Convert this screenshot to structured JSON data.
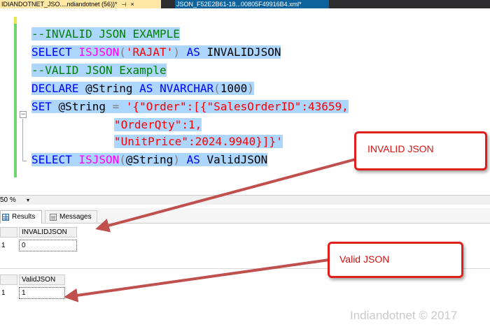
{
  "tabs": {
    "active": "IDIANDOTNET_JSO....ndiandotnet (56))*",
    "active_pin": "⊣",
    "active_close": "×",
    "inactive": "JSON_F52E2B61-18...00805F49916B4.xml*"
  },
  "editor": {
    "lines": [
      {
        "comment": "--INVALID JSON EXAMPLE"
      },
      {
        "kw1": "SELECT",
        "fn": "ISJSON",
        "p1": "(",
        "str": "'RAJAT'",
        "p2": ")",
        "kw2": "AS",
        "id": "INVALIDJSON"
      },
      {
        "comment": "--VALID JSON Example"
      },
      {
        "kw1": "DECLARE",
        "var": "@String",
        "kw2": "AS",
        "type": "NVARCHAR",
        "p1": "(",
        "num": "1000",
        "p2": ")"
      },
      {
        "kw1": "SET",
        "var": "@String",
        "eq": "=",
        "str": "'{\"Order\":[{\"SalesOrderID\":43659,"
      },
      {
        "str": "\"OrderQty\":1,"
      },
      {
        "str": "\"UnitPrice\":2024.9940}]}'"
      },
      {
        "kw1": "SELECT",
        "fn": "ISJSON",
        "p1": "(",
        "var": "@String",
        "p2": ")",
        "kw2": "AS",
        "id": "ValidJSON"
      }
    ],
    "collapse_symbol": "−"
  },
  "zoom": {
    "value": "50 %",
    "dropdown": "▾"
  },
  "results_tabs": {
    "results": "Results",
    "messages": "Messages"
  },
  "grid1": {
    "column": "INVALIDJSON",
    "row_number": "1",
    "value": "0"
  },
  "grid2": {
    "column": "ValidJSON",
    "row_number": "1",
    "value": "1"
  },
  "callouts": {
    "invalid": "INVALID JSON",
    "valid": "Valid JSON"
  },
  "watermark": "Indiandotnet © 2017",
  "colors": {
    "selection": "#add6ff",
    "comment": "#008000",
    "keyword": "#0000ff",
    "function": "#ff00ff",
    "string": "#ff0000",
    "callout_border": "#e01e1e"
  }
}
